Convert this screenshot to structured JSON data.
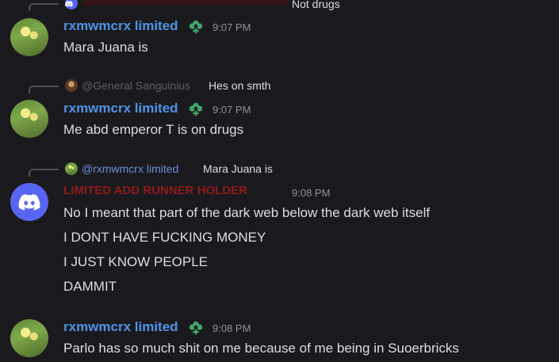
{
  "top_reply": {
    "snippet": "Not drugs"
  },
  "messages": [
    {
      "username": "rxmwmcrx limited",
      "timestamp": "9:07 PM",
      "lines": [
        "Mara Juana is"
      ]
    },
    {
      "reply": {
        "author": "@General Sanguinius",
        "snippet": "Hes on smth"
      },
      "username": "rxmwmcrx limited",
      "timestamp": "9:07 PM",
      "lines": [
        "Me abd emperor T is on drugs"
      ]
    },
    {
      "reply": {
        "author": "@rxmwmcrx limited",
        "snippet": "Mara Juana is"
      },
      "username": "LIMITED ADD RUNNER HOLDER",
      "timestamp": "9:08 PM",
      "lines": [
        "No I meant that part of the dark web below the dark web itself",
        "I DONT HAVE FUCKING MONEY",
        "I JUST KNOW PEOPLE",
        "DAMMIT"
      ]
    },
    {
      "username": "rxmwmcrx limited",
      "timestamp": "9:08 PM",
      "lines": [
        "Parlo has so much shit on me because of me being in Suoerbricks"
      ]
    }
  ],
  "icons": {
    "role_badge": "flower-badge-icon",
    "discord_avatar": "discord-logo-icon"
  },
  "colors": {
    "background": "#1a1a1e",
    "username_blue": "#4f93e6",
    "username_red": "#8e1a1a",
    "discord_blurple": "#5865f2",
    "badge_green": "#3fa56b"
  }
}
